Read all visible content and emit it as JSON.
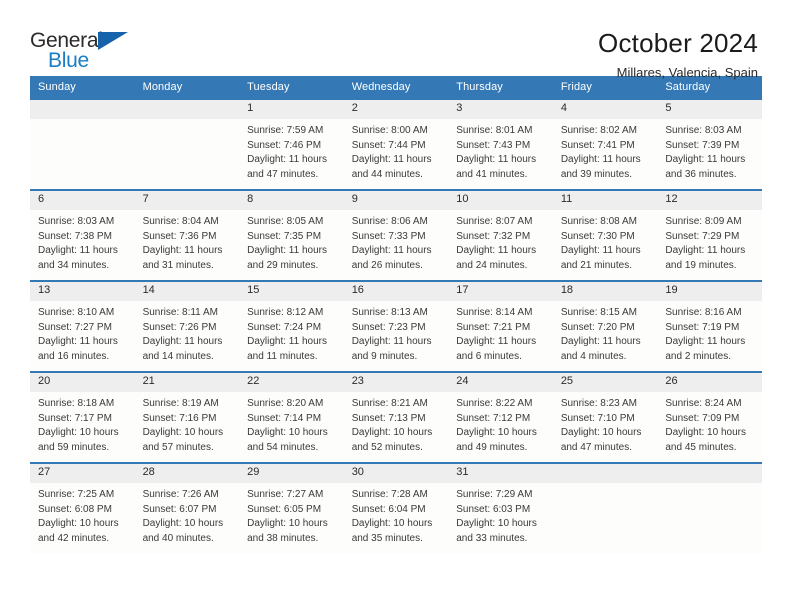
{
  "brand": {
    "name_top": "General",
    "name_bottom": "Blue",
    "triangle_color": "#1763ab",
    "blue_text_color": "#1b7dc4"
  },
  "header": {
    "title": "October 2024",
    "subtitle": "Millares, Valencia, Spain",
    "accent_color": "#3479b6",
    "daynum_band_color": "#eeeeee"
  },
  "weekday_headers": [
    "Sunday",
    "Monday",
    "Tuesday",
    "Wednesday",
    "Thursday",
    "Friday",
    "Saturday"
  ],
  "labels": {
    "sunrise_prefix": "Sunrise:",
    "sunset_prefix": "Sunset:",
    "daylight_prefix": "Daylight:"
  },
  "weeks": [
    [
      {
        "day": "",
        "empty": true,
        "line1": "",
        "line2": "",
        "line3": "",
        "line4": ""
      },
      {
        "day": "",
        "empty": true,
        "line1": "",
        "line2": "",
        "line3": "",
        "line4": ""
      },
      {
        "day": "1",
        "empty": false,
        "line1": "Sunrise: 7:59 AM",
        "line2": "Sunset: 7:46 PM",
        "line3": "Daylight: 11 hours",
        "line4": "and 47 minutes."
      },
      {
        "day": "2",
        "empty": false,
        "line1": "Sunrise: 8:00 AM",
        "line2": "Sunset: 7:44 PM",
        "line3": "Daylight: 11 hours",
        "line4": "and 44 minutes."
      },
      {
        "day": "3",
        "empty": false,
        "line1": "Sunrise: 8:01 AM",
        "line2": "Sunset: 7:43 PM",
        "line3": "Daylight: 11 hours",
        "line4": "and 41 minutes."
      },
      {
        "day": "4",
        "empty": false,
        "line1": "Sunrise: 8:02 AM",
        "line2": "Sunset: 7:41 PM",
        "line3": "Daylight: 11 hours",
        "line4": "and 39 minutes."
      },
      {
        "day": "5",
        "empty": false,
        "line1": "Sunrise: 8:03 AM",
        "line2": "Sunset: 7:39 PM",
        "line3": "Daylight: 11 hours",
        "line4": "and 36 minutes."
      }
    ],
    [
      {
        "day": "6",
        "empty": false,
        "line1": "Sunrise: 8:03 AM",
        "line2": "Sunset: 7:38 PM",
        "line3": "Daylight: 11 hours",
        "line4": "and 34 minutes."
      },
      {
        "day": "7",
        "empty": false,
        "line1": "Sunrise: 8:04 AM",
        "line2": "Sunset: 7:36 PM",
        "line3": "Daylight: 11 hours",
        "line4": "and 31 minutes."
      },
      {
        "day": "8",
        "empty": false,
        "line1": "Sunrise: 8:05 AM",
        "line2": "Sunset: 7:35 PM",
        "line3": "Daylight: 11 hours",
        "line4": "and 29 minutes."
      },
      {
        "day": "9",
        "empty": false,
        "line1": "Sunrise: 8:06 AM",
        "line2": "Sunset: 7:33 PM",
        "line3": "Daylight: 11 hours",
        "line4": "and 26 minutes."
      },
      {
        "day": "10",
        "empty": false,
        "line1": "Sunrise: 8:07 AM",
        "line2": "Sunset: 7:32 PM",
        "line3": "Daylight: 11 hours",
        "line4": "and 24 minutes."
      },
      {
        "day": "11",
        "empty": false,
        "line1": "Sunrise: 8:08 AM",
        "line2": "Sunset: 7:30 PM",
        "line3": "Daylight: 11 hours",
        "line4": "and 21 minutes."
      },
      {
        "day": "12",
        "empty": false,
        "line1": "Sunrise: 8:09 AM",
        "line2": "Sunset: 7:29 PM",
        "line3": "Daylight: 11 hours",
        "line4": "and 19 minutes."
      }
    ],
    [
      {
        "day": "13",
        "empty": false,
        "line1": "Sunrise: 8:10 AM",
        "line2": "Sunset: 7:27 PM",
        "line3": "Daylight: 11 hours",
        "line4": "and 16 minutes."
      },
      {
        "day": "14",
        "empty": false,
        "line1": "Sunrise: 8:11 AM",
        "line2": "Sunset: 7:26 PM",
        "line3": "Daylight: 11 hours",
        "line4": "and 14 minutes."
      },
      {
        "day": "15",
        "empty": false,
        "line1": "Sunrise: 8:12 AM",
        "line2": "Sunset: 7:24 PM",
        "line3": "Daylight: 11 hours",
        "line4": "and 11 minutes."
      },
      {
        "day": "16",
        "empty": false,
        "line1": "Sunrise: 8:13 AM",
        "line2": "Sunset: 7:23 PM",
        "line3": "Daylight: 11 hours",
        "line4": "and 9 minutes."
      },
      {
        "day": "17",
        "empty": false,
        "line1": "Sunrise: 8:14 AM",
        "line2": "Sunset: 7:21 PM",
        "line3": "Daylight: 11 hours",
        "line4": "and 6 minutes."
      },
      {
        "day": "18",
        "empty": false,
        "line1": "Sunrise: 8:15 AM",
        "line2": "Sunset: 7:20 PM",
        "line3": "Daylight: 11 hours",
        "line4": "and 4 minutes."
      },
      {
        "day": "19",
        "empty": false,
        "line1": "Sunrise: 8:16 AM",
        "line2": "Sunset: 7:19 PM",
        "line3": "Daylight: 11 hours",
        "line4": "and 2 minutes."
      }
    ],
    [
      {
        "day": "20",
        "empty": false,
        "line1": "Sunrise: 8:18 AM",
        "line2": "Sunset: 7:17 PM",
        "line3": "Daylight: 10 hours",
        "line4": "and 59 minutes."
      },
      {
        "day": "21",
        "empty": false,
        "line1": "Sunrise: 8:19 AM",
        "line2": "Sunset: 7:16 PM",
        "line3": "Daylight: 10 hours",
        "line4": "and 57 minutes."
      },
      {
        "day": "22",
        "empty": false,
        "line1": "Sunrise: 8:20 AM",
        "line2": "Sunset: 7:14 PM",
        "line3": "Daylight: 10 hours",
        "line4": "and 54 minutes."
      },
      {
        "day": "23",
        "empty": false,
        "line1": "Sunrise: 8:21 AM",
        "line2": "Sunset: 7:13 PM",
        "line3": "Daylight: 10 hours",
        "line4": "and 52 minutes."
      },
      {
        "day": "24",
        "empty": false,
        "line1": "Sunrise: 8:22 AM",
        "line2": "Sunset: 7:12 PM",
        "line3": "Daylight: 10 hours",
        "line4": "and 49 minutes."
      },
      {
        "day": "25",
        "empty": false,
        "line1": "Sunrise: 8:23 AM",
        "line2": "Sunset: 7:10 PM",
        "line3": "Daylight: 10 hours",
        "line4": "and 47 minutes."
      },
      {
        "day": "26",
        "empty": false,
        "line1": "Sunrise: 8:24 AM",
        "line2": "Sunset: 7:09 PM",
        "line3": "Daylight: 10 hours",
        "line4": "and 45 minutes."
      }
    ],
    [
      {
        "day": "27",
        "empty": false,
        "line1": "Sunrise: 7:25 AM",
        "line2": "Sunset: 6:08 PM",
        "line3": "Daylight: 10 hours",
        "line4": "and 42 minutes."
      },
      {
        "day": "28",
        "empty": false,
        "line1": "Sunrise: 7:26 AM",
        "line2": "Sunset: 6:07 PM",
        "line3": "Daylight: 10 hours",
        "line4": "and 40 minutes."
      },
      {
        "day": "29",
        "empty": false,
        "line1": "Sunrise: 7:27 AM",
        "line2": "Sunset: 6:05 PM",
        "line3": "Daylight: 10 hours",
        "line4": "and 38 minutes."
      },
      {
        "day": "30",
        "empty": false,
        "line1": "Sunrise: 7:28 AM",
        "line2": "Sunset: 6:04 PM",
        "line3": "Daylight: 10 hours",
        "line4": "and 35 minutes."
      },
      {
        "day": "31",
        "empty": false,
        "line1": "Sunrise: 7:29 AM",
        "line2": "Sunset: 6:03 PM",
        "line3": "Daylight: 10 hours",
        "line4": "and 33 minutes."
      },
      {
        "day": "",
        "empty": true,
        "line1": "",
        "line2": "",
        "line3": "",
        "line4": ""
      },
      {
        "day": "",
        "empty": true,
        "line1": "",
        "line2": "",
        "line3": "",
        "line4": ""
      }
    ]
  ]
}
